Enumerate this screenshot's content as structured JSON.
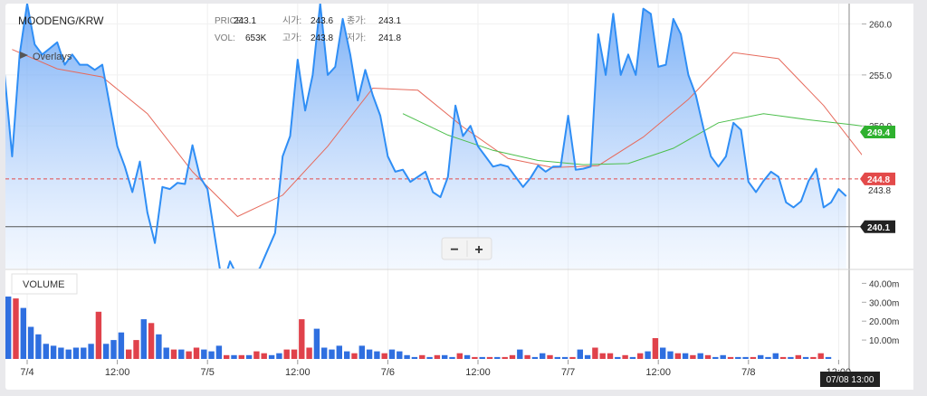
{
  "header": {
    "symbol": "MOODENG/KRW",
    "overlays_label": "Overlays",
    "info": {
      "price_label": "PRICE:",
      "price": "243.1",
      "open_label": "시가:",
      "open": "243.6",
      "close_label": "종가:",
      "close": "243.1",
      "vol_label": "VOL:",
      "vol": "653K",
      "high_label": "고가:",
      "high": "243.8",
      "low_label": "저가:",
      "low": "241.8"
    }
  },
  "zoom": {
    "minus": "−",
    "plus": "+"
  },
  "volume_label": "VOLUME",
  "price_axis": {
    "ticks": [
      "260.0",
      "255.0",
      "250.0"
    ],
    "tick_values": [
      260,
      255,
      250
    ],
    "range": [
      236,
      262
    ]
  },
  "volume_axis": {
    "ticks": [
      "40.00m",
      "30.00m",
      "20.00m",
      "10.00m"
    ],
    "tick_values": [
      40,
      30,
      20,
      10
    ],
    "max": 46
  },
  "time_axis": {
    "ticks": [
      "7/4",
      "12:00",
      "7/5",
      "12:00",
      "7/6",
      "12:00",
      "7/7",
      "12:00",
      "7/8",
      "12:00"
    ]
  },
  "crosshair_label": "07/08 13:00",
  "colors": {
    "price_line": "#2f8ef5",
    "ma_slow": "#e66a5c",
    "ma_long": "#4cbf4c",
    "vol_up": "#e0424b",
    "vol_down": "#2f6fe0",
    "last_price_badge": "#e34a4a",
    "ma_long_badge": "#2fb12f",
    "cursor_badge": "#222222"
  },
  "chart_data": {
    "type": "area",
    "title": "MOODENG/KRW",
    "x_unit": "hours since 7/4 00:00",
    "price": {
      "x_step_hours": 1,
      "x_start": -6,
      "values": [
        253,
        250,
        262,
        255,
        247,
        257,
        262,
        258,
        257,
        257.6,
        258.2,
        256,
        257,
        256,
        256,
        255.5,
        256,
        252,
        248,
        246,
        243.5,
        246.5,
        241.5,
        238.5,
        244,
        243.8,
        244.4,
        244.3,
        248.1,
        245,
        243.8,
        239,
        234.3,
        236.7,
        235.2,
        234.7,
        235,
        236.1,
        237.8,
        239.5,
        247,
        249,
        256.5,
        251.5,
        255,
        262,
        255,
        255.8,
        260.5,
        257,
        252.5,
        255.5,
        253,
        251,
        247,
        245.5,
        245.7,
        244.5,
        245,
        245.5,
        243.5,
        243,
        245,
        252,
        249,
        250,
        248,
        247,
        246,
        246.2,
        246,
        245,
        244,
        244.9,
        246.1,
        245.5,
        246,
        246,
        251,
        245.7,
        245.8,
        246,
        259,
        255,
        261,
        255,
        257,
        255,
        261.5,
        261,
        255.8,
        256,
        260.5,
        259,
        255,
        253,
        249.8,
        247,
        246,
        247,
        250.3,
        249.6,
        244.5,
        243.5,
        244.6,
        245.5,
        245,
        242.5,
        242,
        242.6,
        244.6,
        245.8,
        242,
        242.5,
        243.8,
        243.1
      ]
    },
    "ma_slow": {
      "x": [
        -2,
        4,
        10,
        16,
        22,
        28,
        34,
        40,
        46,
        52,
        58,
        64,
        70,
        76,
        82,
        88,
        94,
        100,
        106,
        112,
        118
      ],
      "values": [
        257.5,
        255.6,
        254.8,
        251.2,
        245.5,
        241.1,
        243.2,
        248,
        253.7,
        253.5,
        249.9,
        246.8,
        245.9,
        246.1,
        248.9,
        252.6,
        257.2,
        256.6,
        252,
        246.3,
        243.1
      ]
    },
    "ma_long": {
      "x": [
        50,
        56,
        62,
        68,
        74,
        80,
        86,
        92,
        98,
        104,
        110,
        117
      ],
      "values": [
        251.2,
        249.1,
        247.6,
        246.6,
        246.2,
        246.3,
        247.8,
        250.3,
        251.2,
        250.6,
        250.1,
        249.4
      ]
    },
    "volume": {
      "unit": "m",
      "values": [
        33,
        32,
        27,
        17,
        13,
        8,
        7,
        6,
        5,
        6,
        6,
        8,
        25,
        8,
        10,
        14,
        5,
        10,
        21,
        19,
        13,
        6,
        5,
        5,
        4,
        6,
        5,
        4,
        7,
        2,
        2,
        2,
        2,
        4,
        3,
        2,
        3,
        5,
        5,
        21,
        6,
        16,
        6,
        5,
        7,
        4,
        3,
        7,
        5,
        4,
        3,
        5,
        4,
        2,
        1,
        2,
        1,
        2,
        2,
        1,
        3,
        2,
        1,
        1,
        1,
        1,
        1,
        2,
        5,
        2,
        1,
        3,
        2,
        1,
        1,
        1,
        5,
        2,
        6,
        3,
        3,
        1,
        2,
        1,
        3,
        4,
        11,
        6,
        4,
        3,
        3,
        2,
        3,
        2,
        1,
        2,
        1,
        1,
        1,
        1,
        2,
        1,
        3,
        1,
        1,
        2,
        1,
        1,
        3,
        1
      ],
      "up": [
        0,
        1,
        0,
        0,
        0,
        0,
        0,
        0,
        0,
        0,
        0,
        0,
        1,
        0,
        0,
        0,
        1,
        1,
        0,
        1,
        0,
        0,
        1,
        0,
        1,
        1,
        0,
        0,
        0,
        1,
        0,
        1,
        0,
        1,
        1,
        0,
        0,
        1,
        1,
        1,
        1,
        0,
        0,
        0,
        0,
        0,
        1,
        0,
        0,
        0,
        1,
        0,
        0,
        0,
        0,
        1,
        0,
        1,
        0,
        0,
        1,
        0,
        1,
        0,
        1,
        0,
        1,
        1,
        0,
        1,
        0,
        0,
        1,
        0,
        0,
        1,
        0,
        0,
        1,
        1,
        1,
        0,
        1,
        0,
        1,
        0,
        1,
        0,
        0,
        1,
        0,
        1,
        0,
        1,
        0,
        0,
        1,
        0,
        0,
        1,
        0,
        0,
        0,
        1,
        0,
        1,
        0,
        1,
        1,
        0
      ]
    },
    "last_price": 244.8,
    "current_price": 243.8,
    "cursor_price": 240.1,
    "ma_long_last": 249.4,
    "ylim": [
      236,
      262
    ],
    "grid": true,
    "legend": "none"
  }
}
